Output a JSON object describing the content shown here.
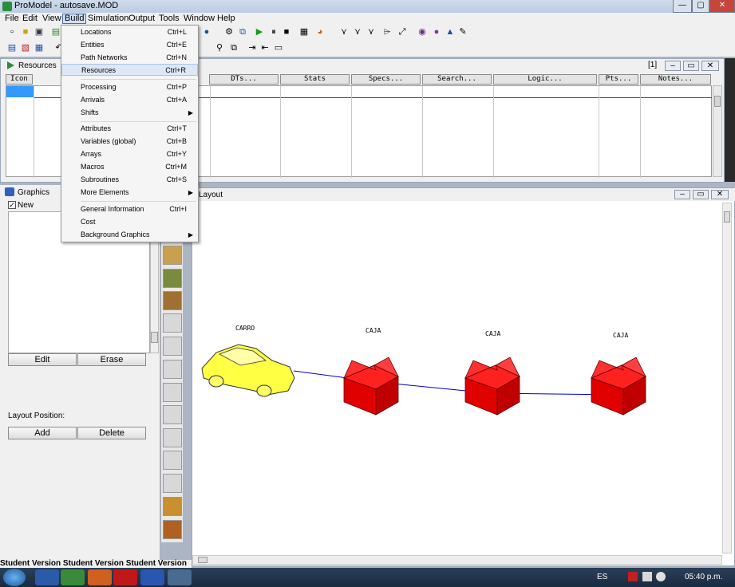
{
  "window": {
    "title": "ProModel - autosave.MOD",
    "buttons": [
      "—",
      "▢",
      "✕"
    ]
  },
  "menubar": [
    "File",
    "Edit",
    "View",
    "Build",
    "Simulation",
    "Output",
    "Tools",
    "Window",
    "Help"
  ],
  "build_menu": {
    "groups": [
      [
        {
          "label": "Locations",
          "shortcut": "Ctrl+L"
        },
        {
          "label": "Entities",
          "shortcut": "Ctrl+E"
        },
        {
          "label": "Path Networks",
          "shortcut": "Ctrl+N"
        },
        {
          "label": "Resources",
          "shortcut": "Ctrl+R",
          "highlighted": true
        }
      ],
      [
        {
          "label": "Processing",
          "shortcut": "Ctrl+P"
        },
        {
          "label": "Arrivals",
          "shortcut": "Ctrl+A"
        },
        {
          "label": "Shifts",
          "submenu": true
        }
      ],
      [
        {
          "label": "Attributes",
          "shortcut": "Ctrl+T"
        },
        {
          "label": "Variables (global)",
          "shortcut": "Ctrl+B"
        },
        {
          "label": "Arrays",
          "shortcut": "Ctrl+Y"
        },
        {
          "label": "Macros",
          "shortcut": "Ctrl+M"
        },
        {
          "label": "Subroutines",
          "shortcut": "Ctrl+S"
        },
        {
          "label": "More Elements",
          "submenu": true
        }
      ],
      [
        {
          "label": "General Information",
          "shortcut": "Ctrl+I"
        },
        {
          "label": "Cost"
        },
        {
          "label": "Background Graphics",
          "submenu": true
        }
      ]
    ]
  },
  "resources_window": {
    "title": "Resources",
    "counter": "[1]",
    "columns": [
      "Icon",
      "DTs...",
      "Stats",
      "Specs...",
      "Search...",
      "Logic...",
      "Pts...",
      "Notes..."
    ]
  },
  "graphics_panel": {
    "title": "Graphics",
    "new_checkbox": "New",
    "new_checked": true,
    "edit_button": "Edit",
    "erase_button": "Erase",
    "layout_position_label": "Layout Position:",
    "add_button": "Add",
    "delete_button": "Delete"
  },
  "layout_window": {
    "title": "Layout",
    "locations": [
      "CARRO",
      "CAJA",
      "CAJA",
      "CAJA"
    ]
  },
  "student_text": "Student Version Student Version Student Version",
  "taskbar": {
    "language": "ES",
    "time": "05:40 p.m."
  },
  "colors": {
    "box_red": "#e00000",
    "car_yellow": "#ffff44",
    "path_blue": "#0000cc"
  }
}
